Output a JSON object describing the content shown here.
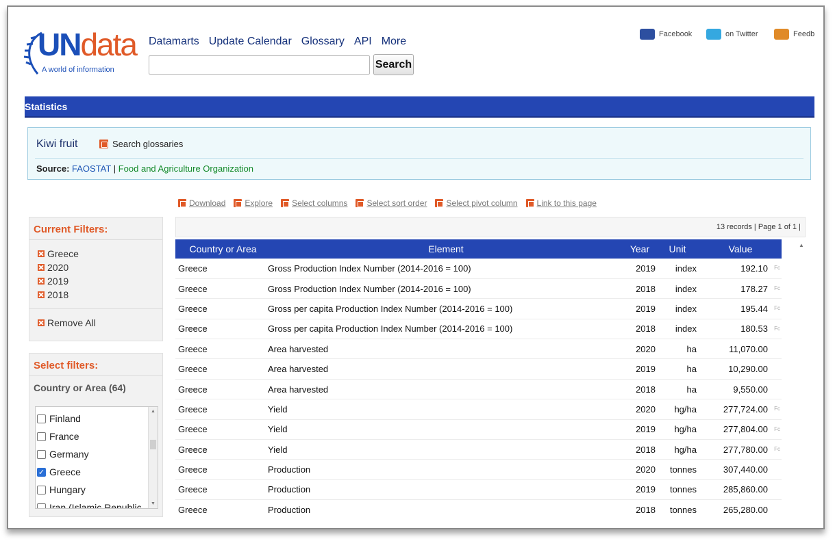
{
  "header": {
    "logo_un": "UN",
    "logo_data": "data",
    "logo_tagline": "A world of information",
    "nav": [
      "Datamarts",
      "Update Calendar",
      "Glossary",
      "API",
      "More"
    ],
    "search_placeholder": "",
    "search_button": "Search",
    "social": [
      {
        "label": "Facebook",
        "color": "#2d4fa0"
      },
      {
        "label": "on Twitter",
        "color": "#35a8e0"
      },
      {
        "label": "Feedb",
        "color": "#e08a28"
      }
    ]
  },
  "statbar": {
    "title": "Statistics"
  },
  "titlebox": {
    "title": "Kiwi fruit",
    "glossary_link": "Search glossaries",
    "source_label": "Source:",
    "source_link1": "FAOSTAT",
    "source_sep": " | ",
    "source_link2": "Food and Agriculture Organization"
  },
  "toolbar": [
    "Download",
    "Explore",
    "Select columns",
    "Select sort order",
    "Select pivot column",
    "Link to this page"
  ],
  "current_filters": {
    "title": "Current Filters:",
    "items": [
      "Greece",
      "2020",
      "2019",
      "2018"
    ],
    "remove_all": "Remove All"
  },
  "select_filters": {
    "title": "Select filters:",
    "subtitle": "Country or Area (64)",
    "options": [
      {
        "label": "Finland",
        "checked": false
      },
      {
        "label": "France",
        "checked": false
      },
      {
        "label": "Germany",
        "checked": false
      },
      {
        "label": "Greece",
        "checked": true
      },
      {
        "label": "Hungary",
        "checked": false
      },
      {
        "label": "Iran (Islamic Republic",
        "checked": false
      }
    ]
  },
  "records": {
    "text": "13 records | Page 1 of 1 |"
  },
  "table": {
    "columns": [
      "Country or Area",
      "Element",
      "Year",
      "Unit",
      "Value"
    ],
    "rows": [
      {
        "country": "Greece",
        "element": "Gross Production Index Number (2014-2016 = 100)",
        "year": "2019",
        "unit": "index",
        "value": "192.10",
        "fn": "Fc"
      },
      {
        "country": "Greece",
        "element": "Gross Production Index Number (2014-2016 = 100)",
        "year": "2018",
        "unit": "index",
        "value": "178.27",
        "fn": "Fc"
      },
      {
        "country": "Greece",
        "element": "Gross per capita Production Index Number (2014-2016 = 100)",
        "year": "2019",
        "unit": "index",
        "value": "195.44",
        "fn": "Fc"
      },
      {
        "country": "Greece",
        "element": "Gross per capita Production Index Number (2014-2016 = 100)",
        "year": "2018",
        "unit": "index",
        "value": "180.53",
        "fn": "Fc"
      },
      {
        "country": "Greece",
        "element": "Area harvested",
        "year": "2020",
        "unit": "ha",
        "value": "11,070.00",
        "fn": ""
      },
      {
        "country": "Greece",
        "element": "Area harvested",
        "year": "2019",
        "unit": "ha",
        "value": "10,290.00",
        "fn": ""
      },
      {
        "country": "Greece",
        "element": "Area harvested",
        "year": "2018",
        "unit": "ha",
        "value": "9,550.00",
        "fn": ""
      },
      {
        "country": "Greece",
        "element": "Yield",
        "year": "2020",
        "unit": "hg/ha",
        "value": "277,724.00",
        "fn": "Fc"
      },
      {
        "country": "Greece",
        "element": "Yield",
        "year": "2019",
        "unit": "hg/ha",
        "value": "277,804.00",
        "fn": "Fc"
      },
      {
        "country": "Greece",
        "element": "Yield",
        "year": "2018",
        "unit": "hg/ha",
        "value": "277,780.00",
        "fn": "Fc"
      },
      {
        "country": "Greece",
        "element": "Production",
        "year": "2020",
        "unit": "tonnes",
        "value": "307,440.00",
        "fn": ""
      },
      {
        "country": "Greece",
        "element": "Production",
        "year": "2019",
        "unit": "tonnes",
        "value": "285,860.00",
        "fn": ""
      },
      {
        "country": "Greece",
        "element": "Production",
        "year": "2018",
        "unit": "tonnes",
        "value": "265,280.00",
        "fn": ""
      }
    ]
  }
}
